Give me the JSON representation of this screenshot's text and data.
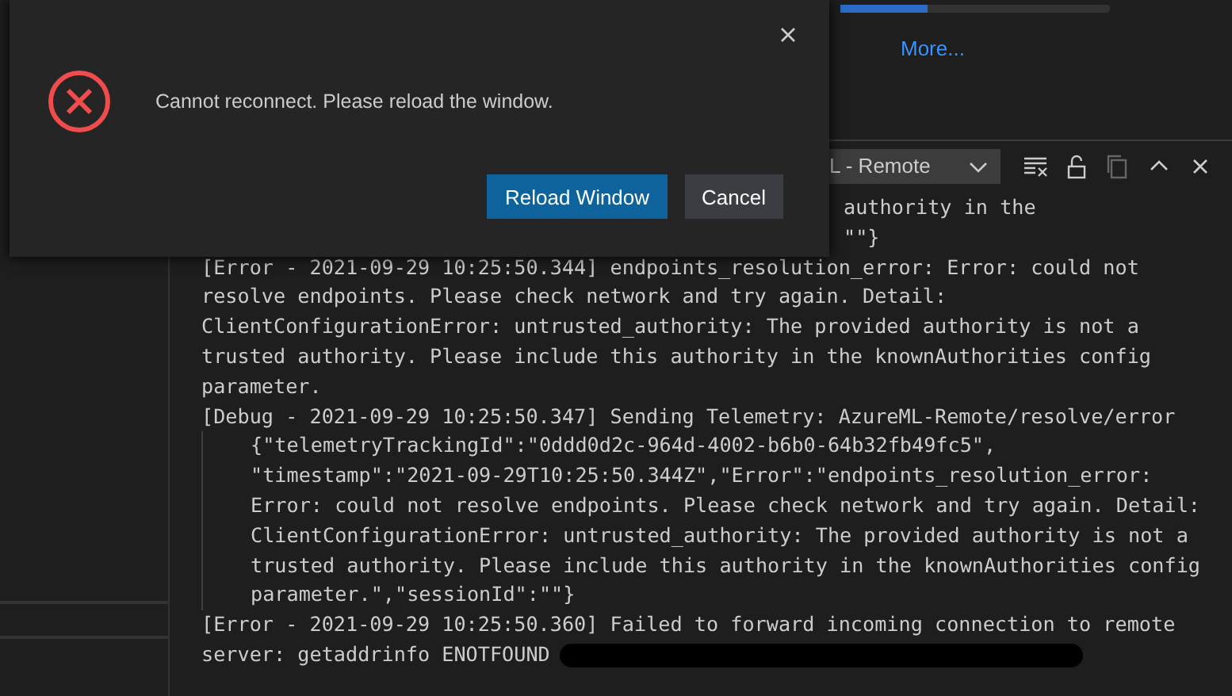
{
  "top_area": {
    "link": "More..."
  },
  "output_panel": {
    "channel": "L - Remote",
    "lines": [
      {
        "kind": "cut",
        "text": "authority in the"
      },
      {
        "kind": "cut",
        "text": "\"\"}"
      },
      {
        "kind": "entry",
        "text": "[Error - 2021-09-29 10:25:50.344] endpoints_resolution_error: Error: could not resolve endpoints. Please check network and try again. Detail: ClientConfigurationError: untrusted_authority: The provided authority is not a trusted authority. Please include this authority in the knownAuthorities config parameter."
      },
      {
        "kind": "entry",
        "text": "[Debug - 2021-09-29 10:25:50.347] Sending Telemetry: AzureML-Remote/resolve/error"
      },
      {
        "kind": "continuation",
        "text": "{\"telemetryTrackingId\":\"0ddd0d2c-964d-4002-b6b0-64b32fb49fc5\", \"timestamp\":\"2021-09-29T10:25:50.344Z\",\"Error\":\"endpoints_resolution_error: Error: could not resolve endpoints. Please check network and try again. Detail: ClientConfigurationError: untrusted_authority: The provided authority is not a trusted authority. Please include this authority in the knownAuthorities config parameter.\",\"sessionId\":\"\"}"
      },
      {
        "kind": "entry",
        "text": "[Error - 2021-09-29 10:25:50.360] Failed to forward incoming connection to remote"
      },
      {
        "kind": "redacted",
        "text": "server: getaddrinfo ENOTFOUND"
      }
    ]
  },
  "dialog": {
    "message": "Cannot reconnect. Please reload the window.",
    "buttons": [
      {
        "label": "Reload Window",
        "primary": true
      },
      {
        "label": "Cancel",
        "primary": false
      }
    ]
  }
}
